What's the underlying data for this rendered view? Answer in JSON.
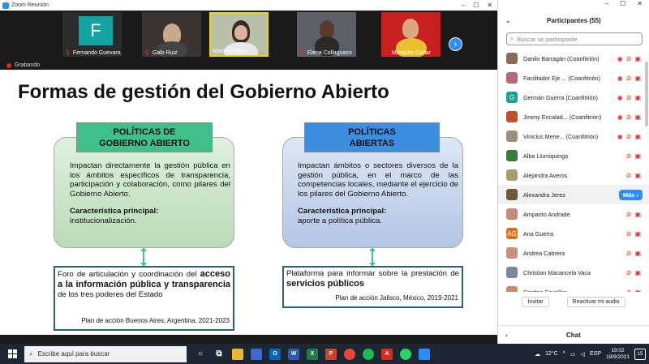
{
  "window": {
    "title": "Zoom Reunión",
    "controls": [
      "–",
      "☐",
      "✕"
    ]
  },
  "video_strip": {
    "tiles": [
      {
        "name": "Fernando Guevara",
        "initial": "F"
      },
      {
        "name": "Galo Ruiz"
      },
      {
        "name": "Marcela Mora"
      },
      {
        "name": "Elena Collaguazo"
      },
      {
        "name": "Marquito Cañar"
      }
    ],
    "next_label": "›"
  },
  "recording": {
    "label": "Grabando"
  },
  "slide": {
    "title": "Formas de gestión del Gobierno Abierto",
    "left": {
      "header_line1": "POLÍTICAS DE",
      "header_line2": "GOBIERNO ABIERTO",
      "body": "Impactan directamente la gestión pública en los ámbitos específicos de transparencia, participación y colaboración, como pilares del Gobierno Abierto.",
      "feature_title": "Característica principal:",
      "feature_text": "institucionalización.",
      "box_text_1": "Foro de articulación y coordinación del",
      "box_bold": "acceso a la información pública y transparencia",
      "box_text_2": "de los tres poderes del Estado",
      "source": "Plan de acción Buenos Aires, Argentina, 2021-2023"
    },
    "right": {
      "header_line1": "POLÍTICAS",
      "header_line2": "ABIERTAS",
      "body": "Impactan ámbitos o sectores diversos de la gestión pública, en el marco de las competencias locales, mediante el ejercicio de los pilares del Gobierno Abierto.",
      "feature_title": "Característica principal:",
      "feature_text": "aporte a política pública.",
      "box_text_1": "Plataforma para informar sobre la prestación de",
      "box_bold": "servicios públicos",
      "source": "Plan de acción Jalisco, México, 2019-2021"
    }
  },
  "participants": {
    "title": "Participantes (55)",
    "search_placeholder": "Buscar un participante",
    "list": [
      {
        "name": "Danilo Barragán (Coanfitrión)",
        "color": "#8a6b5a"
      },
      {
        "name": "Facilitador Eje ... (Coanfitrión)",
        "color": "#b56a7a"
      },
      {
        "name": "Germán Guerra (Coanfitrión)",
        "color": "#1aa38f",
        "initial": "G"
      },
      {
        "name": "Jimmy Encalad... (Coanfitrión)",
        "color": "#c0502a"
      },
      {
        "name": "Vinicius Mene... (Coanfitrión)",
        "color": "#9a8f7a"
      },
      {
        "name": "Alba Llumiquinga",
        "color": "#3a7a3a"
      },
      {
        "name": "Alejandra Averos",
        "color": "#a89c70"
      },
      {
        "name": "Alexandra Jerez",
        "color": "#6b5a3a"
      },
      {
        "name": "Amparito Andrade",
        "color": "#c48a7a"
      },
      {
        "name": "Ana Guerra",
        "color": "#e0701a",
        "initial": "AG"
      },
      {
        "name": "Andrea Cabrera",
        "color": "#c4947a"
      },
      {
        "name": "Christian Macancela Vaca",
        "color": "#7a8a9a"
      },
      {
        "name": "Cristina Cevallos",
        "color": "#c88a6a"
      }
    ],
    "more_label": "Más ›",
    "invite_label": "Invitar",
    "reclaim_label": "Reactivar mi audio"
  },
  "chat": {
    "title": "Chat"
  },
  "taskbar": {
    "search_placeholder": "Escribe aquí para buscar",
    "weather": "12°C",
    "lang": "ESP",
    "time": "19:02",
    "date": "18/9/2021",
    "notifications": "15"
  }
}
